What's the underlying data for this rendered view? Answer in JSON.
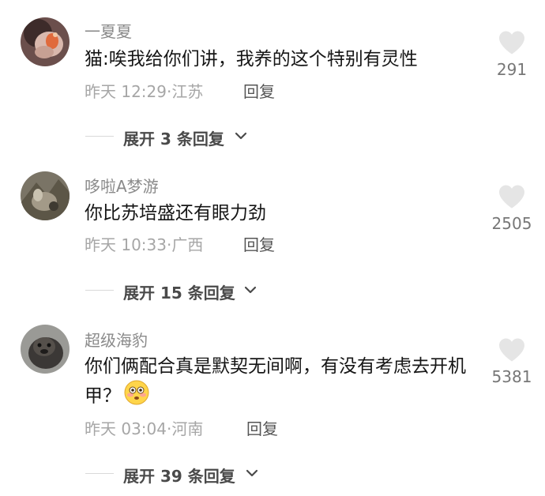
{
  "comments": [
    {
      "username": "一夏夏",
      "text": "猫:唉我给你们讲，我养的这个特别有灵性",
      "time": "昨天 12:29",
      "location": "江苏",
      "reply_label": "回复",
      "likes": "291",
      "expand_label": "展开 3 条回复"
    },
    {
      "username": "哆啦A梦游",
      "text": "你比苏培盛还有眼力劲",
      "time": "昨天 10:33",
      "location": "广西",
      "reply_label": "回复",
      "likes": "2505",
      "expand_label": "展开 15 条回复"
    },
    {
      "username": "超级海豹",
      "text": "你们俩配合真是默契无间啊，有没有考虑去开机甲？",
      "time": "昨天 03:04",
      "location": "河南",
      "reply_label": "回复",
      "likes": "5381",
      "expand_label": "展开 39 条回复",
      "emoji": "flushed-face-emoji"
    }
  ],
  "colors": {
    "username": "#8a8a8a",
    "text": "#161616",
    "meta": "#a6a6a6",
    "heart": "#e5e5e5"
  }
}
